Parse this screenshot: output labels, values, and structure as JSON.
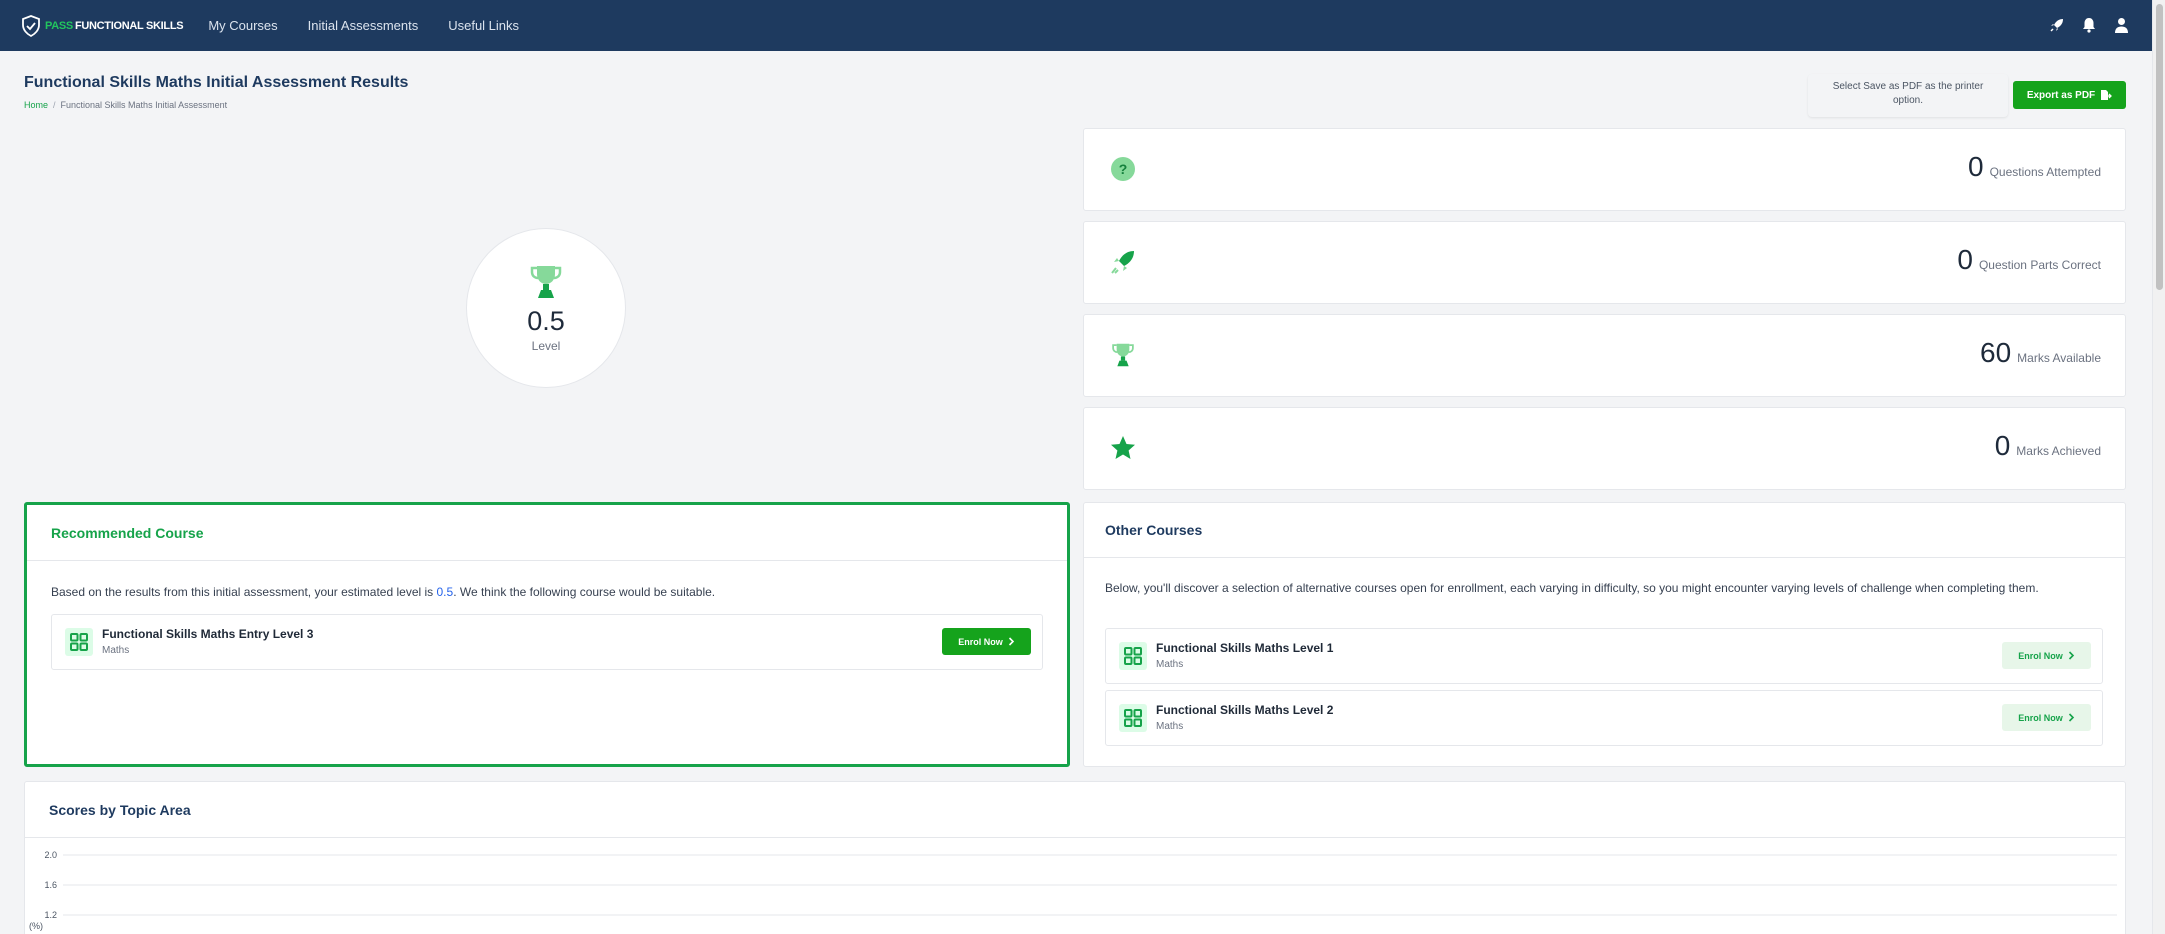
{
  "nav": {
    "brand_pass": "PASS",
    "brand_rest": "FUNCTIONAL SKILLS",
    "links": [
      "My Courses",
      "Initial Assessments",
      "Useful Links"
    ],
    "icons": [
      "rocket-icon",
      "bell-icon",
      "user-icon"
    ]
  },
  "header": {
    "title": "Functional Skills Maths Initial Assessment Results",
    "breadcrumb_home": "Home",
    "breadcrumb_sep": "/",
    "breadcrumb_current": "Functional Skills Maths Initial Assessment",
    "pdf_note": "Select Save as PDF as the printer option.",
    "export_label": "Export as PDF"
  },
  "level": {
    "value": "0.5",
    "label": "Level"
  },
  "stats": [
    {
      "value": "0",
      "label": "Questions Attempted",
      "icon": "question-icon"
    },
    {
      "value": "0",
      "label": "Question Parts Correct",
      "icon": "rocket-icon"
    },
    {
      "value": "60",
      "label": "Marks Available",
      "icon": "trophy-icon"
    },
    {
      "value": "0",
      "label": "Marks Achieved",
      "icon": "star-icon"
    }
  ],
  "recommended": {
    "title": "Recommended Course",
    "text_before": "Based on the results from this initial assessment, your estimated level is ",
    "level": "0.5",
    "text_after": ". We think the following course would be suitable.",
    "course": {
      "name": "Functional Skills Maths Entry Level 3",
      "subject": "Maths",
      "button": "Enrol Now"
    }
  },
  "other": {
    "title": "Other Courses",
    "text": "Below, you'll discover a selection of alternative courses open for enrollment, each varying in difficulty, so you might encounter varying levels of challenge when completing them.",
    "courses": [
      {
        "name": "Functional Skills Maths Level 1",
        "subject": "Maths",
        "button": "Enrol Now"
      },
      {
        "name": "Functional Skills Maths Level 2",
        "subject": "Maths",
        "button": "Enrol Now"
      }
    ]
  },
  "scores": {
    "title": "Scores by Topic Area"
  },
  "chart_data": {
    "type": "bar",
    "title": "",
    "xlabel": "",
    "ylabel": "(%)",
    "y_ticks": [
      "2.0",
      "1.6",
      "1.2"
    ],
    "ylim": [
      0,
      2.0
    ],
    "grid": true,
    "categories": [],
    "values": []
  },
  "colors": {
    "nav": "#1e3a5f",
    "accent": "#16a34a",
    "button": "#15a31c"
  }
}
